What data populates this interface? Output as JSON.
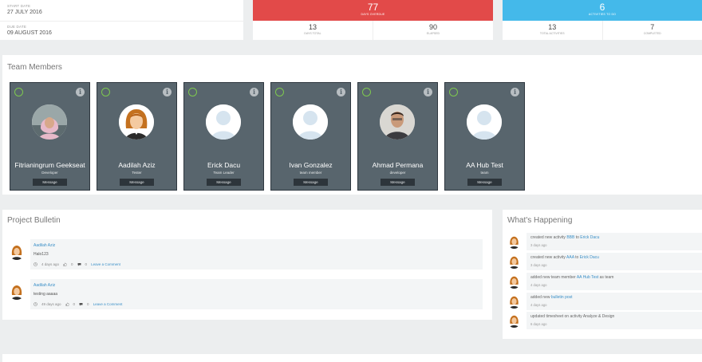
{
  "dates": {
    "start_label": "START DATE",
    "start_value": "27 JULY 2016",
    "due_label": "DUE DATE",
    "due_value": "09 AUGUST 2016"
  },
  "overdue": {
    "value": "77",
    "label": "DAYS OVERDUE",
    "days_total": "13",
    "days_total_label": "DAYS TOTAL",
    "elapsed": "90",
    "elapsed_label": "ELAPSED",
    "color": "#e24a49"
  },
  "activities": {
    "value": "6",
    "label": "ACTIVITIES TO DO",
    "total": "13",
    "total_label": "TOTAL ACTIVITIES",
    "completed": "7",
    "completed_label": "COMPLETED",
    "color": "#44b9ea"
  },
  "team": {
    "title": "Team Members",
    "message_label": "Message",
    "members": [
      {
        "name": "Fitrianingrum Geekseat",
        "role": "Developer",
        "avatar": "photo-woman-hijab"
      },
      {
        "name": "Aadilah Aziz",
        "role": "Tester",
        "avatar": "woman-cartoon"
      },
      {
        "name": "Erick Dacu",
        "role": "Team Leader",
        "avatar": "default-silhouette"
      },
      {
        "name": "Ivan Gonzalez",
        "role": "team member",
        "avatar": "default-silhouette"
      },
      {
        "name": "Ahmad Permana",
        "role": "developer",
        "avatar": "photo-man"
      },
      {
        "name": "AA Hub Test",
        "role": "team",
        "avatar": "default-silhouette"
      }
    ]
  },
  "bulletin": {
    "title": "Project Bulletin",
    "posts": [
      {
        "author": "Aadilah Aziz",
        "text": "Halo123",
        "time": "4 days ago",
        "likes": "0",
        "comments": "0",
        "comment_link": "Leave a Comment"
      },
      {
        "author": "Aadilah Aziz",
        "text": "testing aaaaa",
        "time": "49 days ago",
        "likes": "0",
        "comments": "0",
        "comment_link": "Leave a Comment"
      }
    ]
  },
  "happening": {
    "title": "What's Happening",
    "items": [
      {
        "pre": "created new activity ",
        "link1": "BBB",
        "mid": " to ",
        "link2": "Erick Dacu",
        "post": "",
        "time": "3 days ago"
      },
      {
        "pre": "created new activity ",
        "link1": "AAA",
        "mid": " to ",
        "link2": "Erick Dacu",
        "post": "",
        "time": "3 days ago"
      },
      {
        "pre": "added new team member ",
        "link1": "AA Hub Test",
        "mid": " as ",
        "link2": "",
        "post": "team",
        "time": "4 days ago"
      },
      {
        "pre": "added new ",
        "link1": "bulletin post",
        "mid": "",
        "link2": "",
        "post": "",
        "time": "4 days ago"
      },
      {
        "pre": "updated timesheet on activity ",
        "link1": "",
        "mid": "",
        "link2": "",
        "post": "Analyze & Design",
        "time": "6 days ago"
      }
    ]
  }
}
